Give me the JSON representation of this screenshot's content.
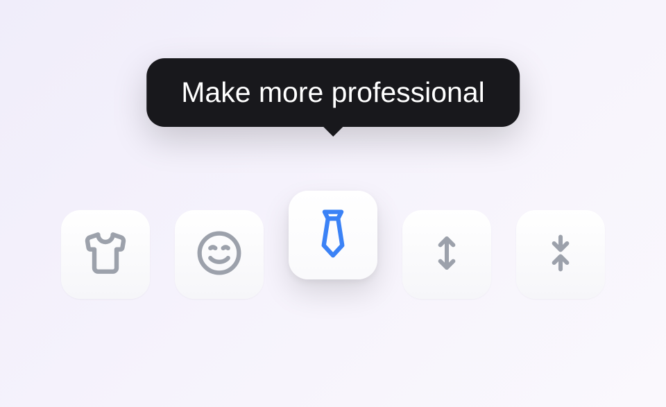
{
  "tooltip": {
    "text": "Make more professional"
  },
  "toolbar": {
    "items": [
      {
        "name": "casual",
        "icon": "tshirt-icon",
        "active": false
      },
      {
        "name": "friendly",
        "icon": "smile-icon",
        "active": false
      },
      {
        "name": "professional",
        "icon": "tie-icon",
        "active": true
      },
      {
        "name": "longer",
        "icon": "expand-vertical-icon",
        "active": false
      },
      {
        "name": "shorter",
        "icon": "collapse-vertical-icon",
        "active": false
      }
    ]
  },
  "colors": {
    "icon_inactive": "#9ca1ab",
    "icon_active": "#3b82f6",
    "tooltip_bg": "#18181c"
  }
}
